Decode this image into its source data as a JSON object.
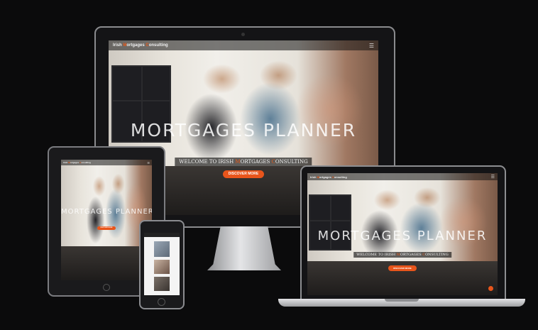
{
  "brand": {
    "part1": "Irish ",
    "part2": "M",
    "part3": "ortgages ",
    "part4": "C",
    "part5": "onsulting"
  },
  "menu_icon": "hamburger-menu-icon",
  "hero": {
    "title": "MORTGAGES PLANNER",
    "welcome_pre": "WELCOME TO ",
    "welcome_brand_i": "IRISH ",
    "welcome_brand_m": "M",
    "welcome_brand_mid": "ORTGAGES ",
    "welcome_brand_c": "C",
    "welcome_brand_end": "ONSULTING",
    "cta": "DISCOVER MORE"
  },
  "colors": {
    "accent": "#e8551b",
    "background": "#0b0b0c",
    "device_frame": "#1a1a1c",
    "laptop_silver": "#c9cacc"
  }
}
